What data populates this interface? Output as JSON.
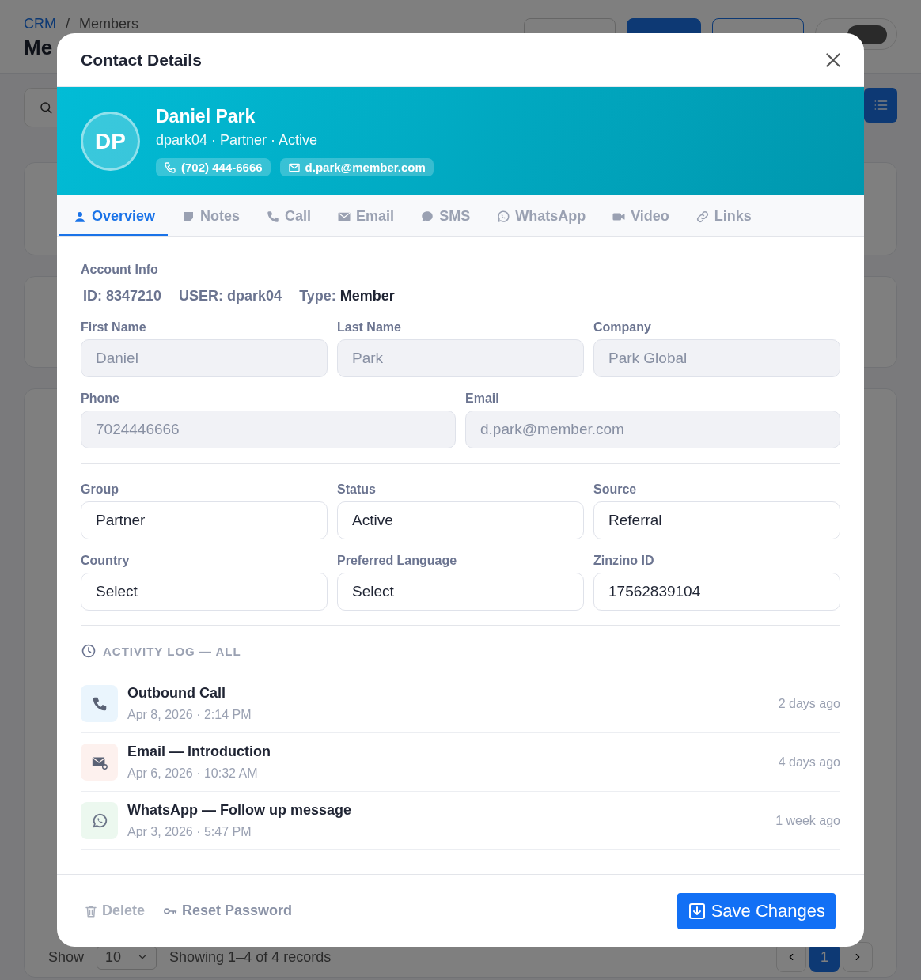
{
  "page": {
    "breadcrumb": [
      {
        "label": "CRM",
        "link": true
      },
      {
        "label": "Members",
        "link": false
      }
    ],
    "breadcrumb_separator": "/",
    "title": "Me",
    "theme_toggle": {
      "on": true
    },
    "table_footer": {
      "show_label": "Show",
      "page_size": "10",
      "summary": "Showing 1–4 of 4 records",
      "pages": [
        {
          "label": "1",
          "selected": true
        }
      ]
    }
  },
  "dialog": {
    "title": "Contact Details",
    "contact": {
      "initials": "DP",
      "name": "Daniel Park",
      "subtitle": "dpark04 · Partner · Active",
      "chips": [
        {
          "kind": "phone",
          "text": "(702) 444-6666"
        },
        {
          "kind": "email",
          "text": "d.park@member.com"
        }
      ]
    },
    "tabs": [
      {
        "label": "Overview",
        "selected": true
      },
      {
        "label": "Notes",
        "selected": false
      },
      {
        "label": "Call",
        "selected": false
      },
      {
        "label": "Email",
        "selected": false
      },
      {
        "label": "SMS",
        "selected": false
      },
      {
        "label": "WhatsApp",
        "selected": false
      },
      {
        "label": "Video",
        "selected": false
      },
      {
        "label": "Links",
        "selected": false
      }
    ],
    "account_info": {
      "heading": "Account Info",
      "meta": [
        {
          "label": "ID:",
          "value": "8347210",
          "emphasis": false
        },
        {
          "label": "USER:",
          "value": "dpark04",
          "emphasis": false
        },
        {
          "label": "Type:",
          "value": "Member",
          "emphasis": true
        }
      ]
    },
    "field_rows": [
      [
        {
          "label": "First Name",
          "value": "Daniel",
          "readonly": true
        },
        {
          "label": "Last Name",
          "value": "Park",
          "readonly": true
        },
        {
          "label": "Company",
          "value": "Park Global",
          "readonly": true
        }
      ],
      [
        {
          "label": "Phone",
          "value": "7024446666",
          "readonly": true
        },
        {
          "label": "Email",
          "value": "d.park@member.com",
          "readonly": true
        }
      ],
      [
        {
          "label": "Group",
          "value": "Partner",
          "readonly": false
        },
        {
          "label": "Status",
          "value": "Active",
          "readonly": false
        },
        {
          "label": "Source",
          "value": "Referral",
          "readonly": false
        }
      ],
      [
        {
          "label": "Country",
          "value": "Select",
          "readonly": false
        },
        {
          "label": "Preferred Language",
          "value": "Select",
          "readonly": false
        },
        {
          "label": "Zinzino ID",
          "value": "17562839104",
          "readonly": false
        }
      ]
    ],
    "activity": {
      "heading": "ACTIVITY LOG — ALL",
      "items": [
        {
          "kind": "call",
          "title": "Outbound Call",
          "time": "Apr 8, 2026 · 2:14 PM",
          "ago": "2 days ago"
        },
        {
          "kind": "email",
          "title": "Email — Introduction",
          "time": "Apr 6, 2026 · 10:32 AM",
          "ago": "4 days ago"
        },
        {
          "kind": "whatsapp",
          "title": "WhatsApp — Follow up message",
          "time": "Apr 3, 2026 · 5:47 PM",
          "ago": "1 week ago"
        }
      ]
    },
    "footer": {
      "delete": {
        "label": "Delete",
        "disabled": true
      },
      "reset": {
        "label": "Reset Password"
      },
      "save": {
        "label": "Save Changes"
      }
    }
  }
}
